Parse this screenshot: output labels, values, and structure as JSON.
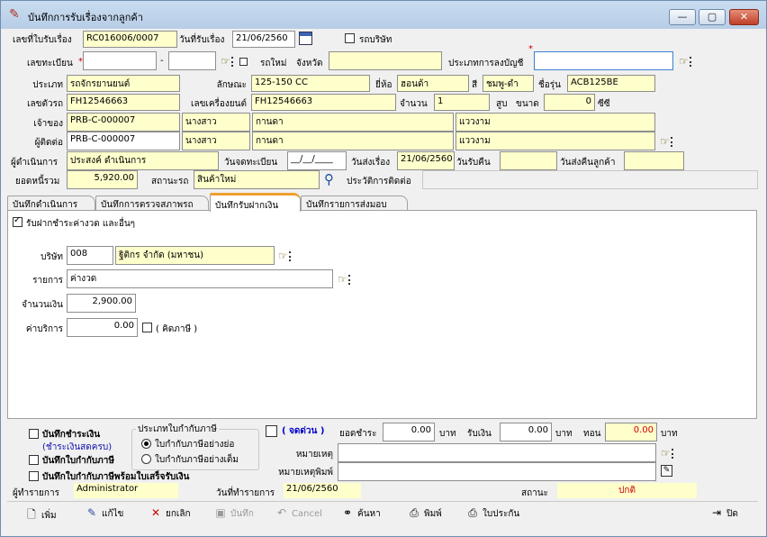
{
  "window": {
    "title": "บันทึกการรับเรื่องจากลูกค้า",
    "min": "—",
    "max": "▢",
    "close": "✕"
  },
  "header": {
    "receipt_no_label": "เลขที่ใบรับเรื่อง",
    "receipt_no": "RC016006/0007",
    "receipt_date_label": "วันที่รับเรื่อง",
    "receipt_date": "21/06/2560",
    "company_car_label": "รถบริษัท",
    "reg_label": "เลขทะเบียน",
    "reg_dash": "-",
    "new_car_label": "รถใหม่",
    "province_label": "จังหวัด",
    "account_type_label": "ประเภทการลงบัญชี"
  },
  "vehicle": {
    "type_label": "ประเภท",
    "type": "รถจักรยานยนต์",
    "desc_label": "ลักษณะ",
    "desc": "125-150 CC",
    "brand_label": "ยี่ห้อ",
    "brand": "ฮอนด้า",
    "color_label": "สี",
    "color": "ชมพู-ดำ",
    "model_label": "ชื่อรุ่น",
    "model": "ACB125BE",
    "chassis_label": "เลขตัวรถ",
    "chassis": "FH12546663",
    "engine_label": "เลขเครื่องยนต์",
    "engine": "FH12546663",
    "qty_label": "จำนวน",
    "qty": "1",
    "cyl_label": "สูบ",
    "size_label": "ขนาด",
    "size": "0",
    "cc": "ซีซี"
  },
  "owner": {
    "label": "เจ้าของ",
    "code": "PRB-C-000007",
    "title": "นางสาว",
    "first": "กานดา",
    "last": "แววงาม"
  },
  "contact": {
    "label": "ผู้ติดต่อ",
    "code": "PRB-C-000007",
    "title": "นางสาว",
    "first": "กานดา",
    "last": "แววงาม"
  },
  "process": {
    "operator_label": "ผู้ดำเนินการ",
    "operator": "ประสงค์ ดำเนินการ",
    "reg_date_label": "วันจดทะเบียน",
    "reg_date": "__/__/____",
    "send_date_label": "วันส่งเรื่อง",
    "send_date": "21/06/2560",
    "return_date_label": "วันรับคืน",
    "return_cust_label": "วันส่งคืนลูกค้า",
    "balance_label": "ยอดหนี้รวม",
    "balance": "5,920.00",
    "car_status_label": "สถานะรถ",
    "car_status": "สินค้าใหม่",
    "history_label": "ประวัติการติดต่อ"
  },
  "tabs": [
    "บันทึกดำเนินการ",
    "บันทึกการตรวจสภาพรถ",
    "บันทึกรับฝากเงิน",
    "บันทึกรายการส่งมอบ"
  ],
  "deposit": {
    "checkbox_label": "รับฝากชำระค่างวด และอื่นๆ",
    "company_label": "บริษัท",
    "company_code": "008",
    "company_name": "ฐิติกร จำกัด (มหาชน)",
    "item_label": "รายการ",
    "item": "ค่างวด",
    "amount_label": "จำนวนเงิน",
    "amount": "2,900.00",
    "fee_label": "ค่าบริการ",
    "fee": "0.00",
    "vat_label": "( คิดภาษี )"
  },
  "footer": {
    "save_payment": "บันทึกชำระเงิน",
    "full_payment": "(ชำระเงินสดครบ)",
    "save_tax_invoice": "บันทึกใบกำกับภาษี",
    "save_tax_with_receipt": "บันทึกใบกำกับภาษีพร้อมใบเสร็จรับเงิน",
    "tax_type_label": "ประเภทใบกำกับภาษี",
    "tax_short": "ใบกำกับภาษีอย่างย่อ",
    "tax_full": "ใบกำกับภาษีอย่างเต็ม",
    "urgent": "( จดด่วน )",
    "due_label": "ยอดชำระ",
    "due": "0.00",
    "baht1": "บาท",
    "received_label": "รับเงิน",
    "received": "0.00",
    "baht2": "บาท",
    "change_label": "ทอน",
    "change": "0.00",
    "baht3": "บาท",
    "note_label": "หมายเหตุ",
    "note_print_label": "หมายเหตุพิมพ์",
    "creator_label": "ผู้ทำรายการ",
    "creator": "Administrator",
    "trans_date_label": "วันที่ทำรายการ",
    "trans_date": "21/06/2560",
    "status_label": "สถานะ",
    "status": "ปกติ"
  },
  "toolbar": {
    "add": "เพิ่ม",
    "edit": "แก้ไข",
    "cancel_doc": "ยกเลิก",
    "save": "บันทึก",
    "cancel": "Cancel",
    "search": "ค้นหา",
    "print": "พิมพ์",
    "voucher": "ใบประกัน",
    "close": "ปิด"
  },
  "colors": {
    "accent": "#ffffcc",
    "urgent": "#0000cc",
    "negative": "#cc0000",
    "title_bar": "#c9dcf0"
  }
}
